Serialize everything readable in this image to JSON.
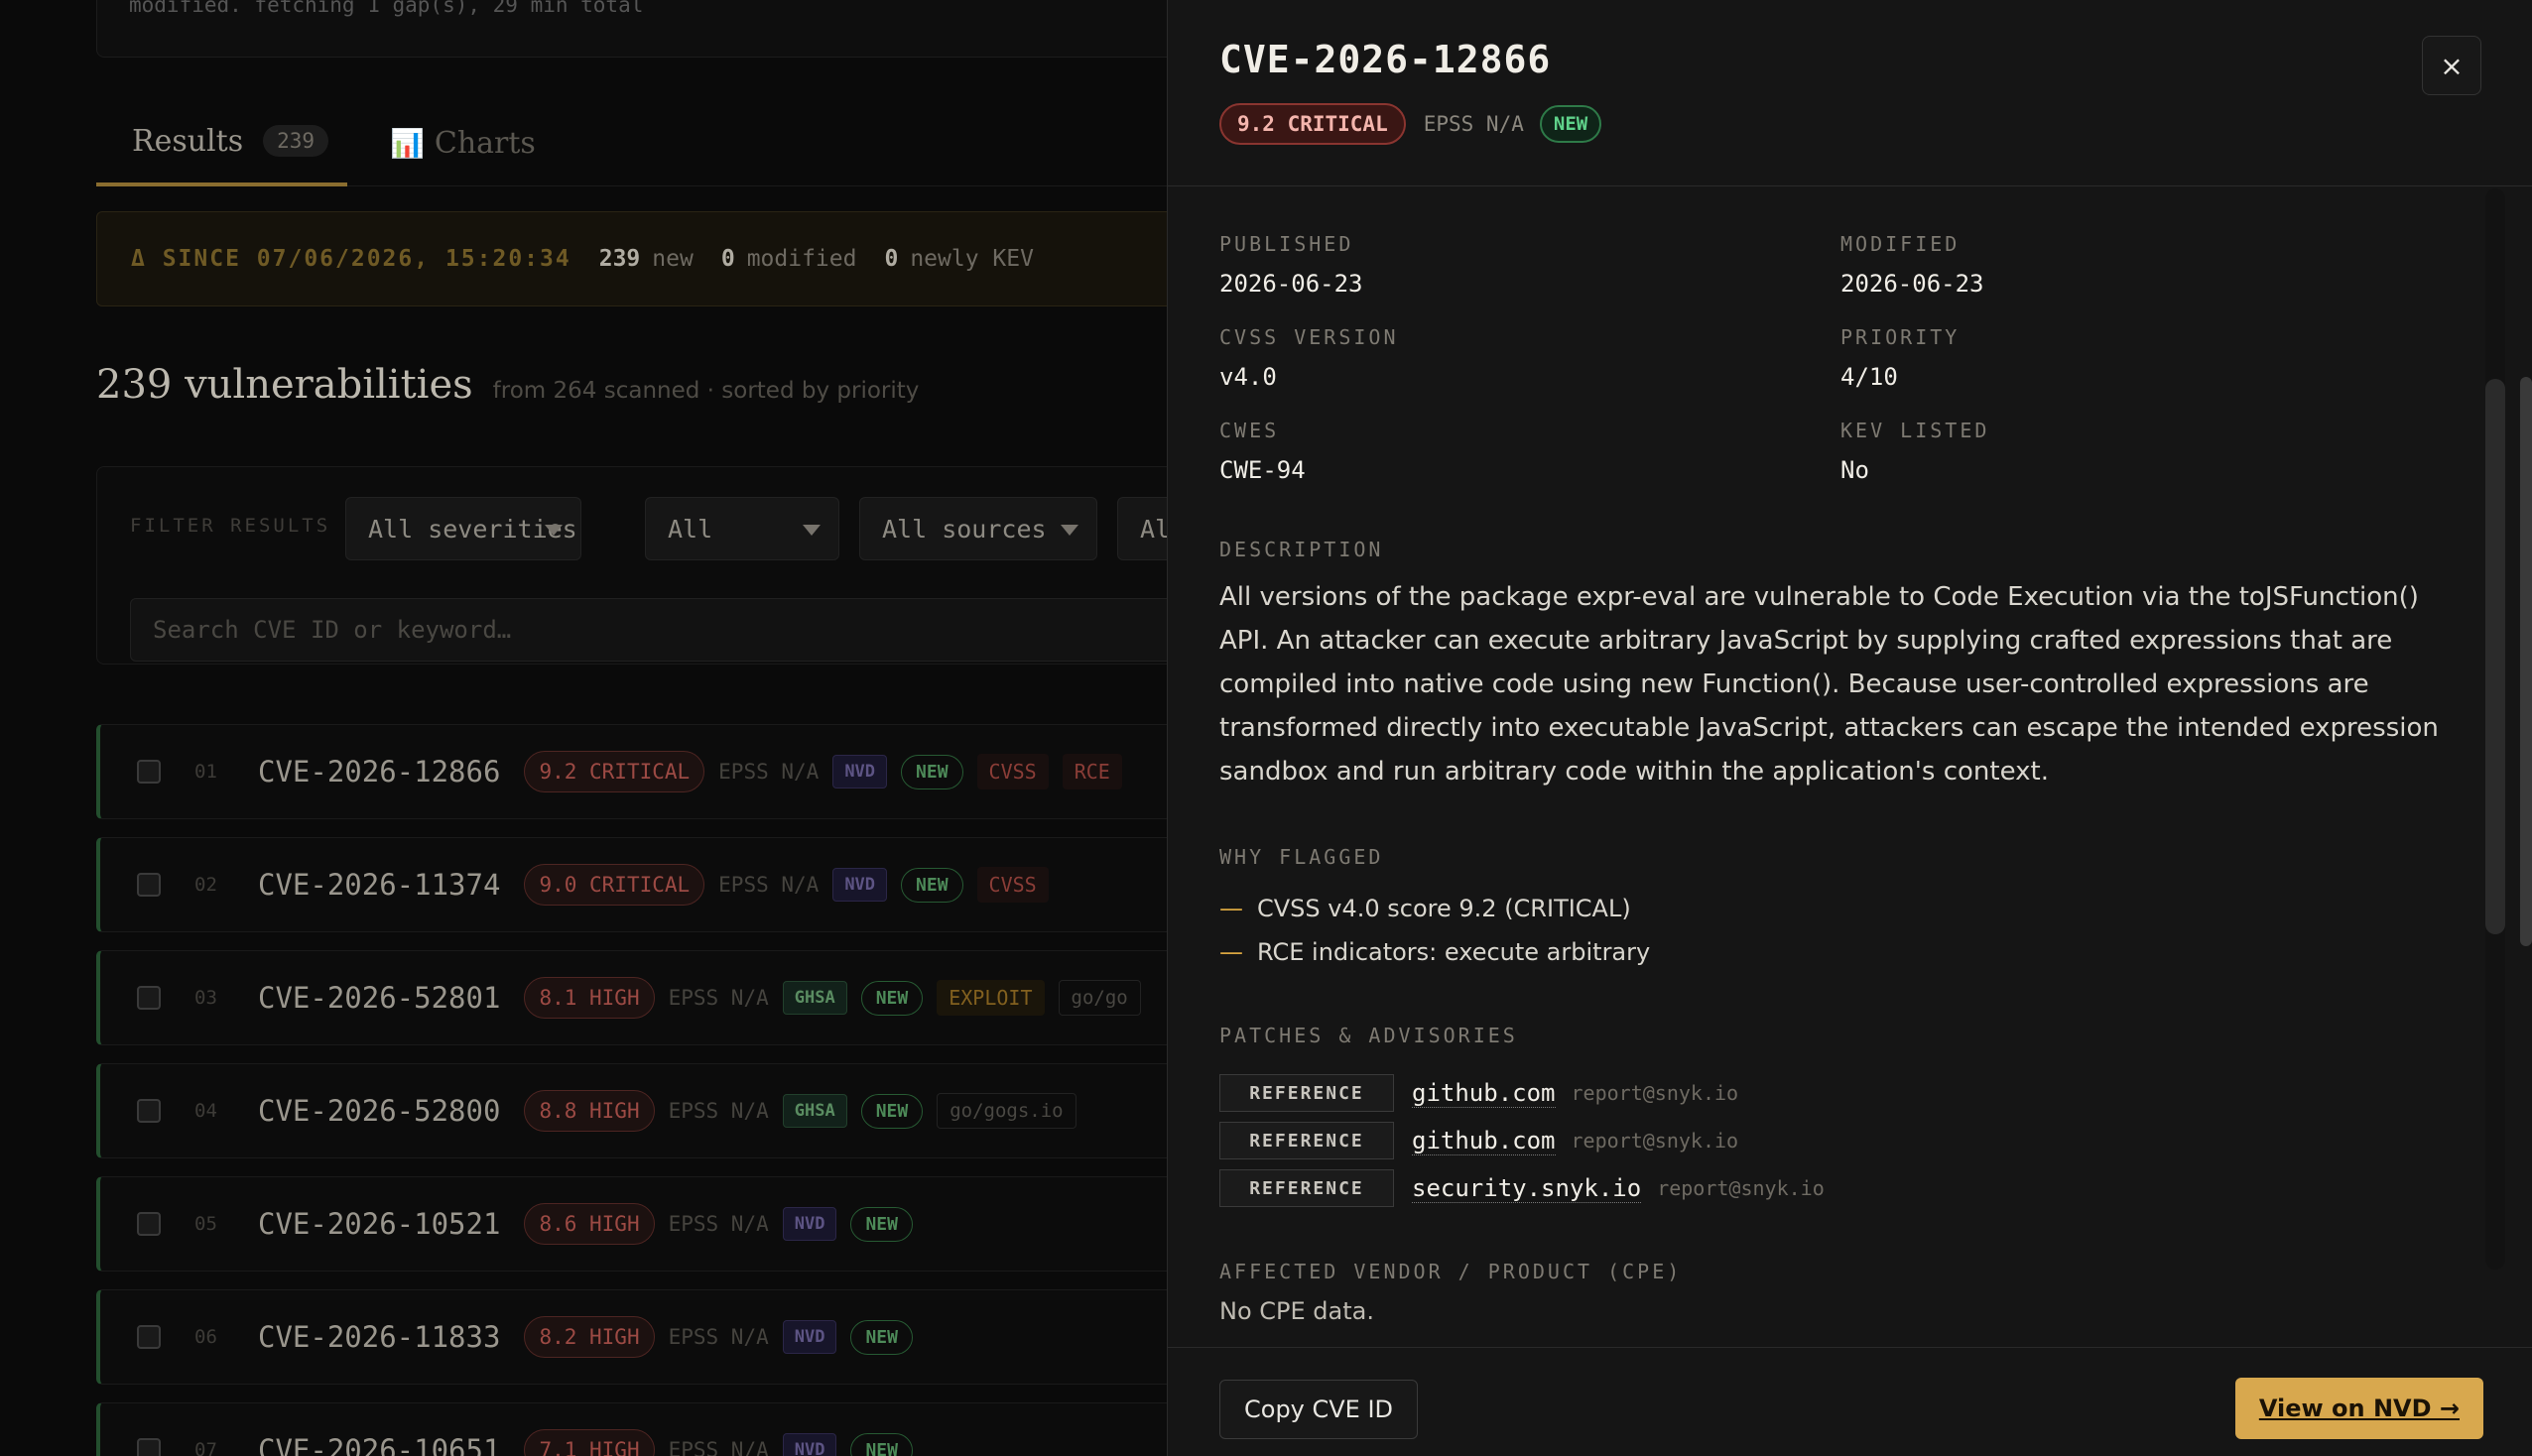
{
  "background": {
    "status_line": "modified. fetching 1 gap(s), 29 min total",
    "tabs": [
      {
        "label": "Results",
        "count": "239"
      },
      {
        "label": "Charts",
        "icon": "📊"
      }
    ],
    "since": {
      "label": "Δ SINCE 07/06/2026, 15:20:34",
      "new_count": "239",
      "new_label": "new",
      "modified_count": "0",
      "modified_label": "modified",
      "kev_count": "0",
      "kev_label": "newly KEV"
    },
    "heading": {
      "title": "239 vulnerabilities",
      "subtitle": "from 264 scanned · sorted by priority"
    },
    "filters": {
      "label": "FILTER RESULTS",
      "severity": "All severities",
      "type": "All",
      "sources": "All sources",
      "extra": "Al",
      "search_placeholder": "Search CVE ID or keyword…"
    },
    "rows": [
      {
        "idx": "01",
        "cve": "CVE-2026-12866",
        "sev": "9.2 CRITICAL",
        "epss": "EPSS N/A",
        "src": "NVD",
        "new": "NEW",
        "tags": [
          "CVSS",
          "RCE"
        ],
        "pkg": ""
      },
      {
        "idx": "02",
        "cve": "CVE-2026-11374",
        "sev": "9.0 CRITICAL",
        "epss": "EPSS N/A",
        "src": "NVD",
        "new": "NEW",
        "tags": [
          "CVSS"
        ],
        "pkg": ""
      },
      {
        "idx": "03",
        "cve": "CVE-2026-52801",
        "sev": "8.1 HIGH",
        "epss": "EPSS N/A",
        "src": "GHSA",
        "new": "NEW",
        "tags": [
          "EXPLOIT"
        ],
        "pkg": "go/go"
      },
      {
        "idx": "04",
        "cve": "CVE-2026-52800",
        "sev": "8.8 HIGH",
        "epss": "EPSS N/A",
        "src": "GHSA",
        "new": "NEW",
        "tags": [],
        "pkg": "go/gogs.io"
      },
      {
        "idx": "05",
        "cve": "CVE-2026-10521",
        "sev": "8.6 HIGH",
        "epss": "EPSS N/A",
        "src": "NVD",
        "new": "NEW",
        "tags": [],
        "pkg": ""
      },
      {
        "idx": "06",
        "cve": "CVE-2026-11833",
        "sev": "8.2 HIGH",
        "epss": "EPSS N/A",
        "src": "NVD",
        "new": "NEW",
        "tags": [],
        "pkg": ""
      },
      {
        "idx": "07",
        "cve": "CVE-2026-10651",
        "sev": "7.1 HIGH",
        "epss": "EPSS N/A",
        "src": "NVD",
        "new": "NEW",
        "tags": [],
        "pkg": ""
      }
    ]
  },
  "drawer": {
    "title": "CVE-2026-12866",
    "severity_badge": "9.2 CRITICAL",
    "epss": "EPSS N/A",
    "new_badge": "NEW",
    "close_label": "×",
    "fields": {
      "published_label": "PUBLISHED",
      "published": "2026-06-23",
      "modified_label": "MODIFIED",
      "modified": "2026-06-23",
      "cvss_version_label": "CVSS VERSION",
      "cvss_version": "v4.0",
      "priority_label": "PRIORITY",
      "priority": "4/10",
      "cwes_label": "CWES",
      "cwes": "CWE-94",
      "kev_label": "KEV LISTED",
      "kev": "No"
    },
    "description_label": "DESCRIPTION",
    "description": "All versions of the package expr-eval are vulnerable to Code Execution via the toJSFunction() API. An attacker can execute arbitrary JavaScript by supplying crafted expressions that are compiled into native code using new Function(). Because user-controlled expressions are transformed directly into executable JavaScript, attackers can escape the intended expression sandbox and run arbitrary code within the application's context.",
    "why_label": "WHY FLAGGED",
    "why": [
      "CVSS v4.0 score 9.2 (CRITICAL)",
      "RCE indicators: execute arbitrary"
    ],
    "patches_label": "PATCHES & ADVISORIES",
    "patches": [
      {
        "type": "REFERENCE",
        "host": "github.com",
        "email": "report@snyk.io"
      },
      {
        "type": "REFERENCE",
        "host": "github.com",
        "email": "report@snyk.io"
      },
      {
        "type": "REFERENCE",
        "host": "security.snyk.io",
        "email": "report@snyk.io"
      }
    ],
    "cpe_label": "AFFECTED VENDOR / PRODUCT (CPE)",
    "cpe": "No CPE data.",
    "copy_button": "Copy CVE ID",
    "nvd_button": "View on NVD →"
  },
  "colors": {
    "accent": "#d8a84e",
    "critical": "#8a3530",
    "new_green": "#5fd28a"
  }
}
